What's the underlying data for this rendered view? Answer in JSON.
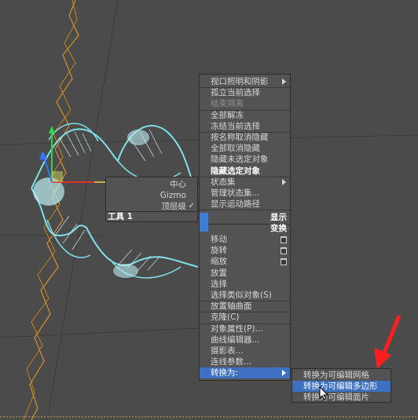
{
  "quad_main": {
    "top_items": [
      {
        "label": "视口照明和阴影",
        "submenu": true
      },
      {
        "label": "孤立当前选择"
      },
      {
        "label": "结束隔离",
        "disabled": true
      },
      {
        "label": "全部解冻"
      },
      {
        "label": "冻结当前选择"
      },
      {
        "label": "按名称取消隐藏"
      },
      {
        "label": "全部取消隐藏"
      },
      {
        "label": "隐藏未选定对象"
      },
      {
        "label": "隐藏选定对象",
        "bold": true
      },
      {
        "label": "状态集",
        "submenu": true
      },
      {
        "label": "管理状态集..."
      },
      {
        "label": "显示运动路径"
      }
    ],
    "header_display": "显示",
    "header_transform": "变换",
    "bottom_items": [
      {
        "label": "移动",
        "icon": "settings-box-icon"
      },
      {
        "label": "旋转",
        "icon": "settings-box-icon"
      },
      {
        "label": "缩放",
        "icon": "settings-box-icon"
      },
      {
        "label": "放置"
      },
      {
        "label": "选择"
      },
      {
        "label": "选择类似对象(S)"
      },
      {
        "label": "放置轴曲面"
      },
      {
        "label": "克隆(C)"
      },
      {
        "label": "对象属性(P)..."
      },
      {
        "label": "曲线编辑器..."
      },
      {
        "label": "摄影表..."
      },
      {
        "label": "连线参数..."
      },
      {
        "label": "转换为:",
        "submenu": true,
        "highlighted": true
      }
    ]
  },
  "quad_left": {
    "items": [
      {
        "label": "中心"
      },
      {
        "label": "Gizmo"
      },
      {
        "label": "顶层级",
        "checked": true
      }
    ],
    "header_tools": "工具 1"
  },
  "convert_submenu": {
    "items": [
      {
        "label": "转换为可编辑网格"
      },
      {
        "label": "转换为可编辑多边形",
        "highlighted": true
      },
      {
        "label": "转换为可编辑面片"
      }
    ]
  },
  "colors": {
    "viewport_bg": "#4a4a4a",
    "menu_bg": "#535353",
    "highlight": "#3d6fc2",
    "helix": "#7fe0ea",
    "spline": "#d9902a",
    "annotation_arrow": "#ff1f1f"
  }
}
